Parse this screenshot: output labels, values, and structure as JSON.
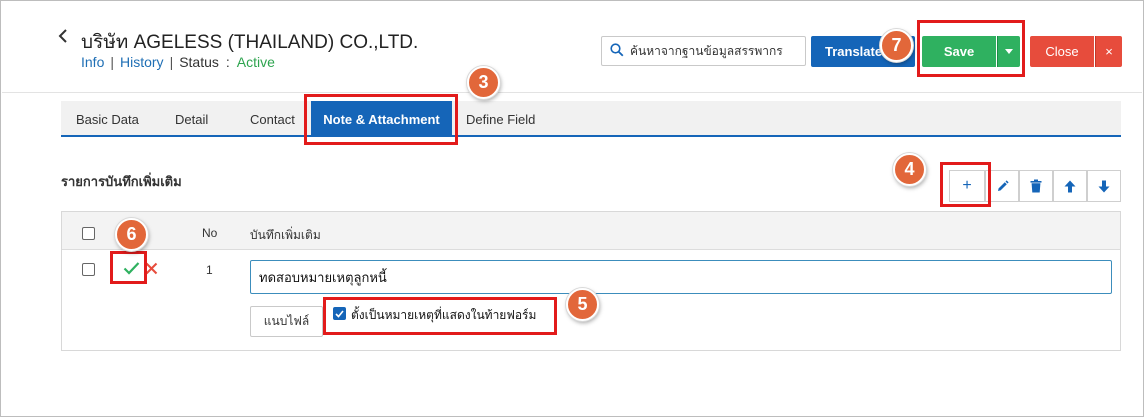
{
  "header": {
    "company": "บริษัท AGELESS (THAILAND) CO.,LTD.",
    "links": {
      "info": "Info",
      "history": "History",
      "separator": "|"
    },
    "status_label": "Status",
    "status_colon": ":",
    "status_value": "Active"
  },
  "search": {
    "placeholder": "ค้นหาจากฐานข้อมูลสรรพากร"
  },
  "actions": {
    "translate": "Translate",
    "save": "Save",
    "close": "Close",
    "close_x": "×"
  },
  "tabs": [
    {
      "label": "Basic Data"
    },
    {
      "label": "Detail"
    },
    {
      "label": "Contact"
    },
    {
      "label": "Note & Attachment"
    },
    {
      "label": "Define Field"
    }
  ],
  "section": {
    "title": "รายการบันทึกเพิ่มเติม",
    "toolbar_add": "+"
  },
  "table": {
    "headers": {
      "no": "No",
      "note": "บันทึกเพิ่มเติม"
    },
    "rows": [
      {
        "no": "1",
        "note": "ทดสอบหมายเหตุลูกหนี้",
        "attach_label": "แนบไฟล์",
        "show_in_form_label": "ตั้งเป็นหมายเหตุที่แสดงในท้ายฟอร์ม"
      }
    ]
  },
  "annotations": {
    "m3": "3",
    "m4": "4",
    "m5": "5",
    "m6": "6",
    "m7": "7"
  },
  "colors": {
    "primary": "#1565b8",
    "success": "#2fb160",
    "danger": "#e74c3c",
    "active_status": "#2ea44f",
    "annotation_box": "#e21b1b",
    "annotation_marker": "#e2673a"
  }
}
